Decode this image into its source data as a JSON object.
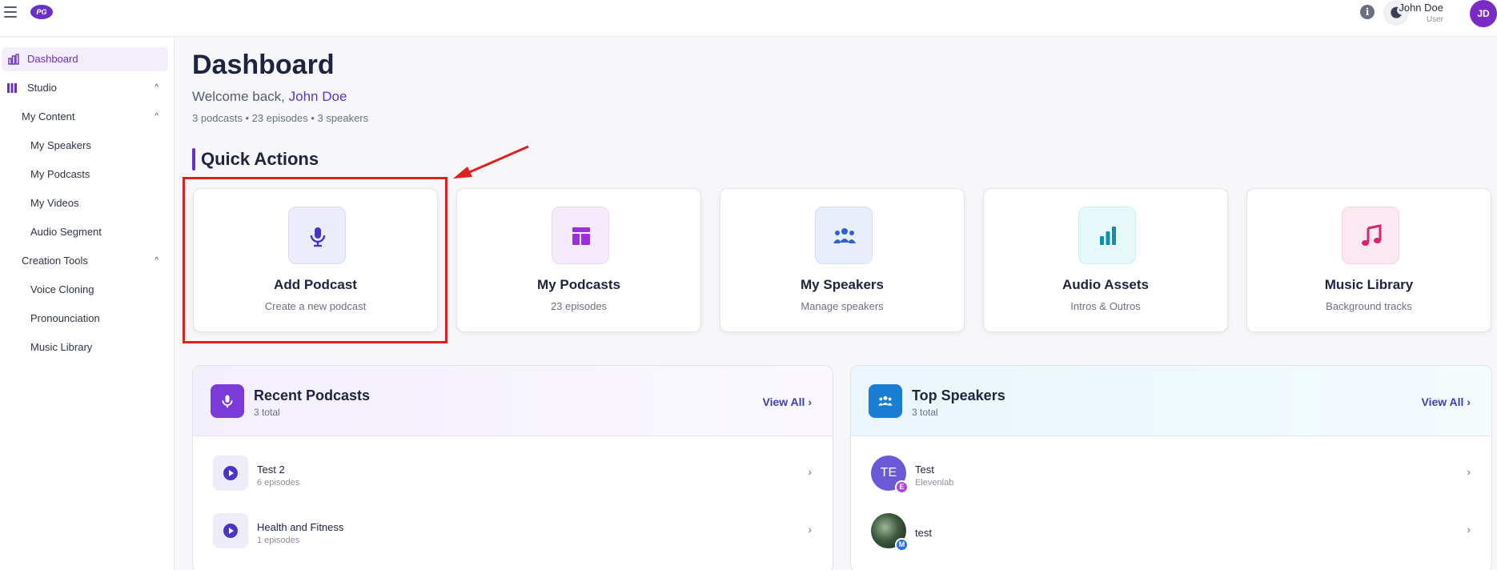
{
  "topbar": {
    "logo_text": "PG",
    "user_name": "John Doe",
    "user_role": "User",
    "avatar_initials": "JD"
  },
  "sidebar": {
    "items": [
      {
        "label": "Dashboard",
        "icon": "bar-chart-icon",
        "active": true
      },
      {
        "label": "Studio",
        "icon": "columns-icon",
        "expanded": true
      },
      {
        "label": "My Content",
        "expanded": true
      },
      {
        "label": "My Speakers"
      },
      {
        "label": "My Podcasts"
      },
      {
        "label": "My Videos"
      },
      {
        "label": "Audio Segment"
      },
      {
        "label": "Creation Tools",
        "expanded": true
      },
      {
        "label": "Voice Cloning"
      },
      {
        "label": "Pronounciation"
      },
      {
        "label": "Music Library"
      }
    ]
  },
  "main": {
    "title": "Dashboard",
    "welcome_prefix": "Welcome back,",
    "welcome_name": "John Doe",
    "stats": "3 podcasts • 23 episodes • 3 speakers",
    "quick_actions_title": "Quick Actions",
    "quick_actions": [
      {
        "title": "Add Podcast",
        "subtitle": "Create a new podcast",
        "icon": "microphone-icon",
        "color": "#4b34c8",
        "bg": "#ececfb"
      },
      {
        "title": "My Podcasts",
        "subtitle": "23 episodes",
        "icon": "layout-icon",
        "color": "#9b30d9",
        "bg": "#f6ebfc"
      },
      {
        "title": "My Speakers",
        "subtitle": "Manage speakers",
        "icon": "group-icon",
        "color": "#2f5fd0",
        "bg": "#e9eefc"
      },
      {
        "title": "Audio Assets",
        "subtitle": "Intros & Outros",
        "icon": "bar-chart-icon",
        "color": "#0e8fb0",
        "bg": "#e6f8fa"
      },
      {
        "title": "Music Library",
        "subtitle": "Background tracks",
        "icon": "music-note-icon",
        "color": "#d6246e",
        "bg": "#fce8f0"
      }
    ]
  },
  "recent_podcasts": {
    "title": "Recent Podcasts",
    "subtitle": "3 total",
    "view_all": "View All",
    "items": [
      {
        "title": "Test 2",
        "subtitle": "6 episodes"
      },
      {
        "title": "Health and Fitness",
        "subtitle": "1 episodes"
      }
    ]
  },
  "top_speakers": {
    "title": "Top Speakers",
    "subtitle": "3 total",
    "view_all": "View All",
    "items": [
      {
        "name": "Test",
        "provider": "Elevenlab",
        "initials": "TE",
        "badge": "E",
        "badge_color": "#b044e0"
      },
      {
        "name": "test",
        "provider": "",
        "initials": "",
        "badge": "M",
        "badge_color": "#2f6fd8"
      }
    ]
  }
}
